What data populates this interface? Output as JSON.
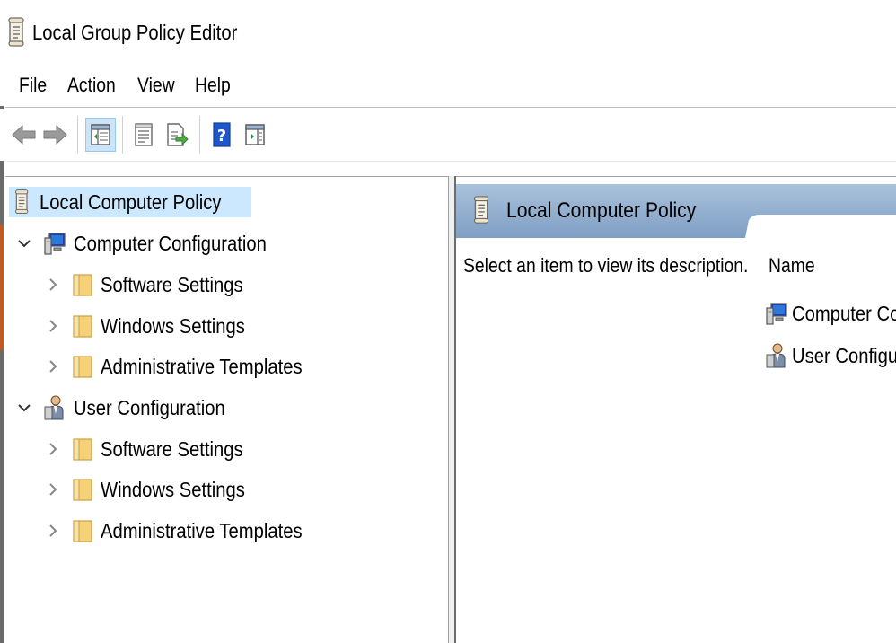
{
  "window": {
    "title": "Local Group Policy Editor",
    "icon": "scroll-policy-icon"
  },
  "menu": [
    "File",
    "Action",
    "View",
    "Help"
  ],
  "toolbar": {
    "buttons": [
      {
        "name": "back-icon"
      },
      {
        "name": "forward-icon"
      },
      {
        "name": "show-hide-console-tree-icon",
        "active": true
      },
      {
        "name": "properties-icon"
      },
      {
        "name": "export-list-icon"
      },
      {
        "name": "help-icon"
      },
      {
        "name": "show-hide-action-pane-icon"
      }
    ]
  },
  "tree": {
    "root": "Local Computer Policy",
    "nodes": [
      {
        "label": "Computer Configuration",
        "icon": "computer-icon",
        "expanded": true,
        "children": [
          "Software Settings",
          "Windows Settings",
          "Administrative Templates"
        ]
      },
      {
        "label": "User Configuration",
        "icon": "user-icon",
        "expanded": true,
        "children": [
          "Software Settings",
          "Windows Settings",
          "Administrative Templates"
        ]
      }
    ]
  },
  "details": {
    "header": "Local Computer Policy",
    "description": "Select an item to view its description.",
    "column_name": "Name",
    "items": [
      {
        "label": "Computer Con",
        "icon": "computer-icon"
      },
      {
        "label": "User Configura",
        "icon": "user-icon"
      }
    ]
  },
  "colors": {
    "header_band": "#8aa8c8",
    "selection": "#cce8ff",
    "folder": "#f5d27a"
  }
}
